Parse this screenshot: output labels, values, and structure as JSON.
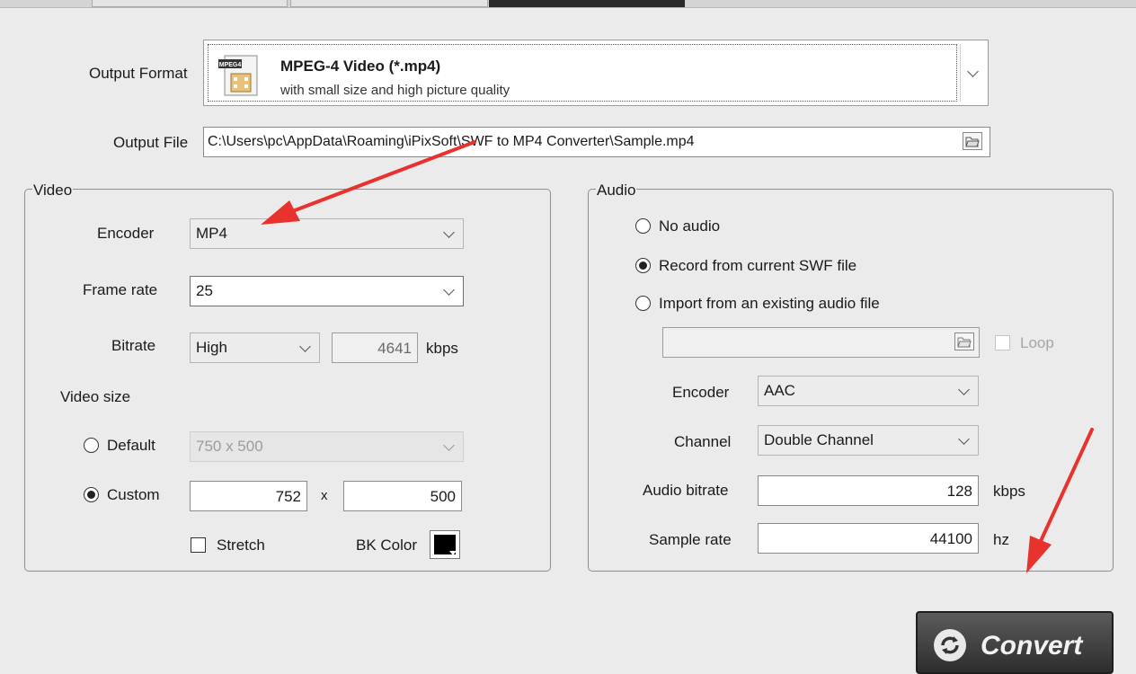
{
  "output_format": {
    "label": "Output Format",
    "title": "MPEG-4 Video (*.mp4)",
    "description": "with small size and high picture quality",
    "icon_badge": "MPEG4"
  },
  "output_file": {
    "label": "Output File",
    "value": "C:\\Users\\pc\\AppData\\Roaming\\iPixSoft\\SWF to MP4 Converter\\Sample.mp4"
  },
  "video": {
    "legend": "Video",
    "encoder_label": "Encoder",
    "encoder_value": "MP4",
    "frame_rate_label": "Frame rate",
    "frame_rate_value": "25",
    "bitrate_label": "Bitrate",
    "bitrate_value": "High",
    "bitrate_kbps": "4641",
    "bitrate_unit": "kbps",
    "video_size_label": "Video size",
    "default_label": "Default",
    "default_size": "750 x 500",
    "default_selected": false,
    "custom_label": "Custom",
    "custom_selected": true,
    "custom_width": "752",
    "times": "x",
    "custom_height": "500",
    "stretch_label": "Stretch",
    "stretch_checked": false,
    "bk_color_label": "BK Color",
    "bk_color": "#000000"
  },
  "audio": {
    "legend": "Audio",
    "no_audio_label": "No audio",
    "record_label": "Record from current SWF file",
    "import_label": "Import from an existing audio file",
    "selected_option": "record",
    "import_path": "",
    "loop_label": "Loop",
    "encoder_label": "Encoder",
    "encoder_value": "AAC",
    "channel_label": "Channel",
    "channel_value": "Double Channel",
    "bitrate_label": "Audio bitrate",
    "bitrate_value": "128",
    "bitrate_unit": "kbps",
    "sample_rate_label": "Sample rate",
    "sample_rate_value": "44100",
    "sample_rate_unit": "hz"
  },
  "convert": {
    "label": "Convert"
  },
  "annotation_color": "#e8322e"
}
